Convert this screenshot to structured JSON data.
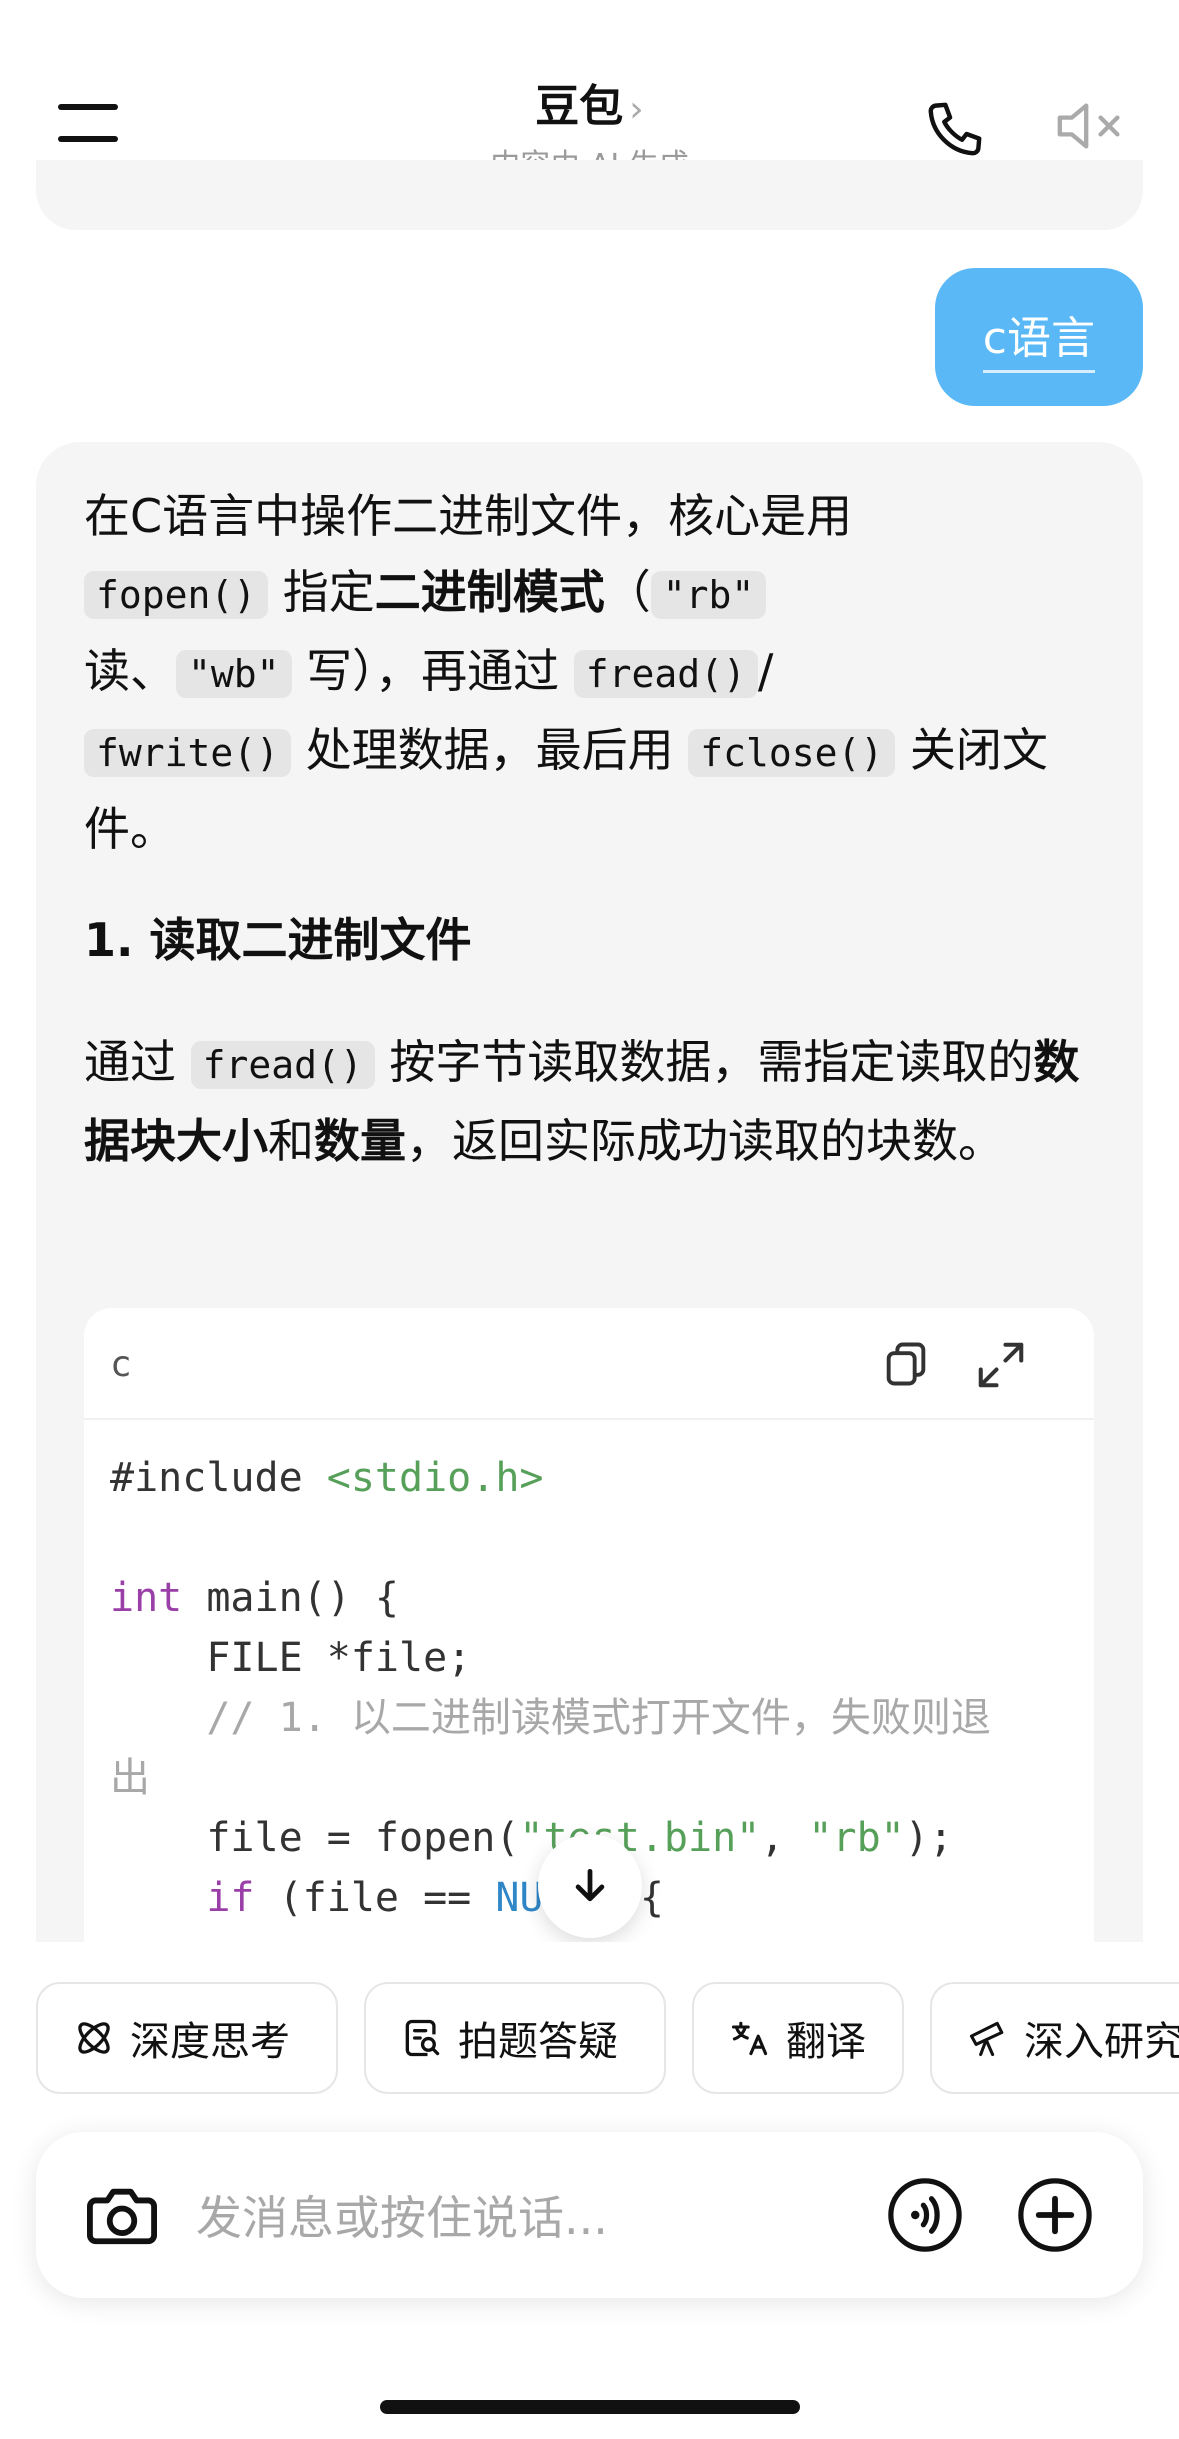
{
  "header": {
    "title": "豆包",
    "title_chevron": "›",
    "subtitle": "内容由 AI 生成",
    "icons": [
      "menu-icon",
      "phone-icon",
      "speaker-muted-icon"
    ]
  },
  "user_message": "c语言",
  "assistant": {
    "intro": {
      "p1": "在C语言中操作二进制文件，核心是用",
      "c_fopen": "fopen()",
      "p2": " 指定",
      "b_mode": "二进制模式",
      "p3": "（",
      "c_rb": "\"rb\"",
      "p4": "读、",
      "c_wb": "\"wb\"",
      "p5": " 写），再通过 ",
      "c_fread": "fread()",
      "p6": "/",
      "c_fwrite": "fwrite()",
      "p7": " 处理数据，最后用 ",
      "c_fclose": "fclose()",
      "p8": " 关闭文件。"
    },
    "section1_title": "1. 读取二进制文件",
    "section1_body": {
      "p1": "通过 ",
      "c_fread": "fread()",
      "p2": " 按字节读取数据，需指定读取的",
      "b1": "数据块大小",
      "p3": "和",
      "b2": "数量",
      "p4": "，返回实际成功读取的块数。"
    },
    "code_block": {
      "language": "c",
      "copy_icon": "copy-icon",
      "expand_icon": "expand-icon",
      "l1_a": "#include ",
      "l1_b": "<stdio.h>",
      "l3_a": "int",
      "l3_b": " main() {",
      "l4": "    FILE *file;",
      "l5": "    // 1. 以二进制读模式打开文件，失败则退",
      "l6": "出",
      "l7_a": "    file = fopen(",
      "l7_b": "\"test.bin\"",
      "l7_c": ", ",
      "l7_d": "\"rb\"",
      "l7_e": ");",
      "l8_a": "    ",
      "l8_b": "if",
      "l8_c": " (file == ",
      "l8_d": "NULL",
      "l8_e": ") {"
    }
  },
  "quick_actions": [
    {
      "label": "深度思考",
      "icon": "deep-think-icon"
    },
    {
      "label": "拍题答疑",
      "icon": "photo-question-icon"
    },
    {
      "label": "翻译",
      "icon": "translate-icon"
    },
    {
      "label": "深入研究",
      "icon": "telescope-icon"
    }
  ],
  "input": {
    "placeholder": "发消息或按住说话...",
    "icons": [
      "camera-icon",
      "voice-call-icon",
      "plus-icon"
    ]
  },
  "colors": {
    "user_bubble": "#5ab8f7",
    "card_bg": "#f5f5f5",
    "code_string": "#57a05a",
    "code_keyword": "#9a3fa8",
    "code_comment": "#a8a8a8"
  }
}
